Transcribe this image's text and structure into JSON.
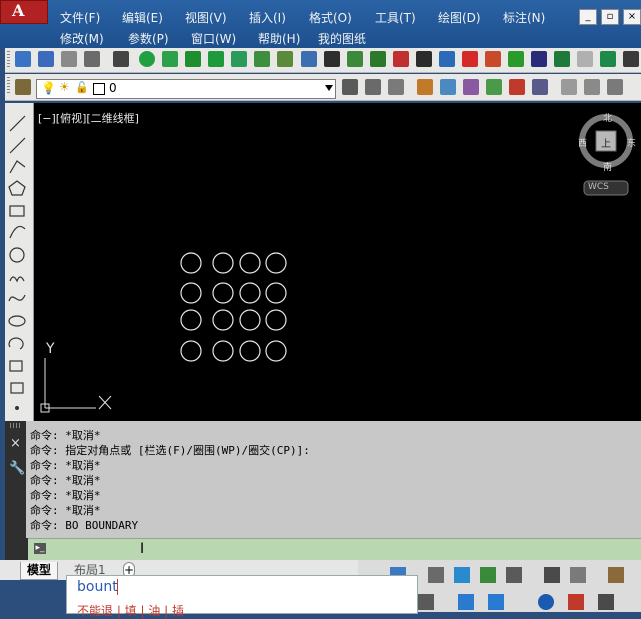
{
  "app": {
    "logo_letter": "A"
  },
  "menu": {
    "row1": [
      "文件(F)",
      "编辑(E)",
      "视图(V)",
      "插入(I)",
      "格式(O)",
      "工具(T)",
      "绘图(D)",
      "标注(N)"
    ],
    "row2": [
      "修改(M)",
      "参数(P)",
      "窗口(W)",
      "帮助(H)",
      "我的图纸"
    ]
  },
  "layer": {
    "current": "0"
  },
  "viewport": {
    "label": "[−][俯视][二维线框]",
    "compass": {
      "north": "北",
      "south": "南",
      "east": "东",
      "west": "西",
      "top": "上"
    },
    "wcs": "WCS",
    "ucs": {
      "y": "Y",
      "x": "X"
    }
  },
  "command": {
    "history": [
      "命令: *取消*",
      "命令: 指定对角点或 [栏选(F)/圈围(WP)/圈交(CP)]:",
      "命令: *取消*",
      "命令: *取消*",
      "命令: *取消*",
      "命令: *取消*",
      "命令: BO BOUNDARY"
    ],
    "input_prompt": "▸_"
  },
  "tabs": {
    "model": "模型",
    "layout1": "布局1",
    "add": "+"
  },
  "autocomplete": {
    "typed": "bount",
    "suggestion_partial": "不能退 | 填 | 油 | 插"
  },
  "colors": {
    "canvas": "#000000",
    "cmd_bg": "#c8c8c8",
    "cmd_input": "#b9d7b0",
    "title": "#1d4f8d"
  }
}
